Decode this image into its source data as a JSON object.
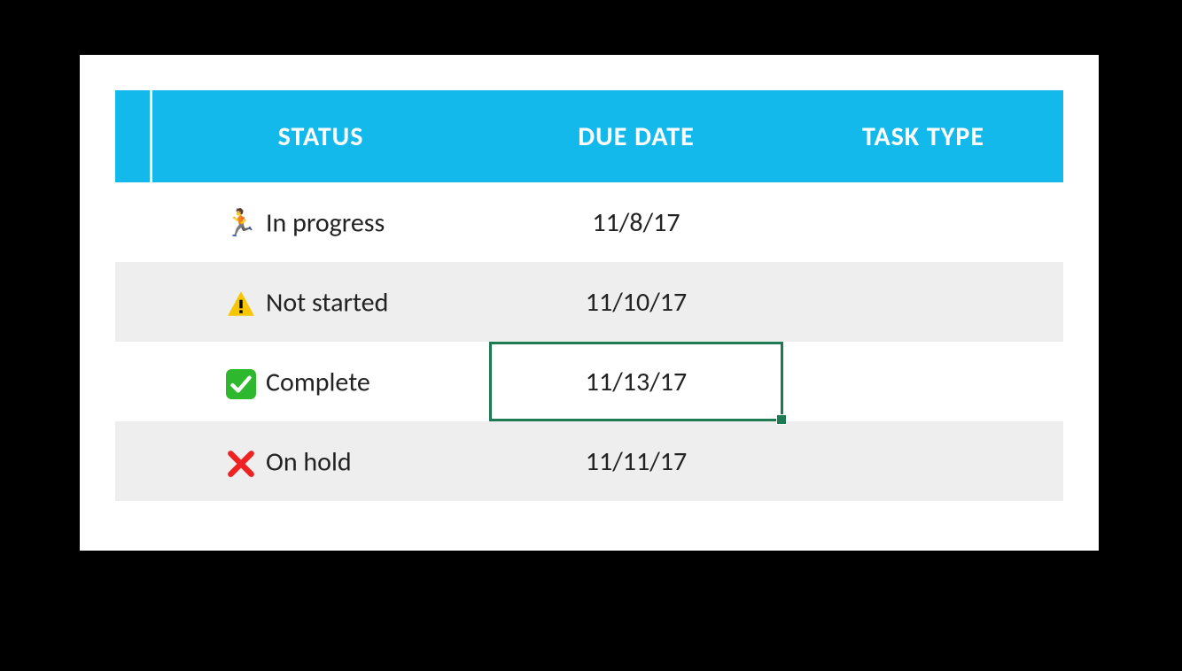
{
  "table": {
    "headers": {
      "blank": "",
      "status": "STATUS",
      "due_date": "DUE DATE",
      "task_type": "TASK TYPE"
    },
    "rows": [
      {
        "icon": "runner-icon",
        "status": "In progress",
        "due_date": "11/8/17",
        "task_type": ""
      },
      {
        "icon": "warning-icon",
        "status": "Not started",
        "due_date": "11/10/17",
        "task_type": ""
      },
      {
        "icon": "check-icon",
        "status": "Complete",
        "due_date": "11/13/17",
        "task_type": ""
      },
      {
        "icon": "cross-icon",
        "status": "On hold",
        "due_date": "11/11/17",
        "task_type": ""
      }
    ],
    "selected_cell": {
      "row": 2,
      "col": "due_date"
    }
  },
  "colors": {
    "header_bg": "#14B9EC",
    "selection": "#1e7a53",
    "row_alt": "#eeeeee"
  }
}
